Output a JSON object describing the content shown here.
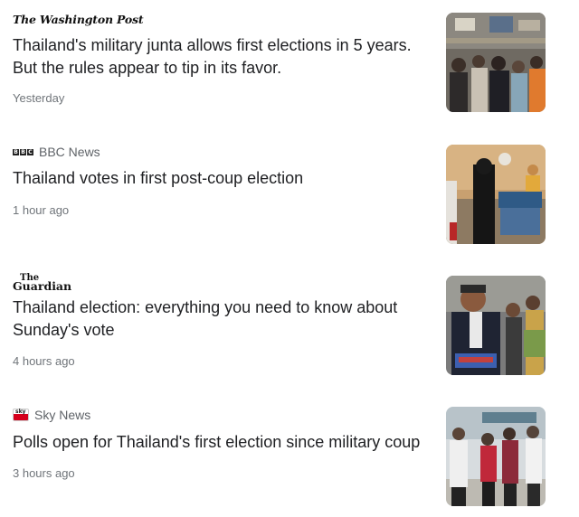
{
  "articles": [
    {
      "source": "The Washington Post",
      "headline": "Thailand's military junta allows first elections in 5 years. But the rules appear to tip in its favor.",
      "time": "Yesterday"
    },
    {
      "source": "BBC News",
      "headline": "Thailand votes in first post-coup election",
      "time": "1 hour ago"
    },
    {
      "source": "The Guardian",
      "headline": "Thailand election: everything you need to know about Sunday's vote",
      "time": "4 hours ago"
    },
    {
      "source": "Sky News",
      "headline": "Polls open for Thailand's first election since military coup",
      "time": "3 hours ago"
    }
  ],
  "logos": {
    "bbc": [
      "B",
      "B",
      "C"
    ],
    "guardian_the": "The",
    "guardian_name": "Guardian"
  },
  "colors": {
    "headline": "#202124",
    "meta": "#70757a",
    "sky_red": "#d6001c"
  }
}
